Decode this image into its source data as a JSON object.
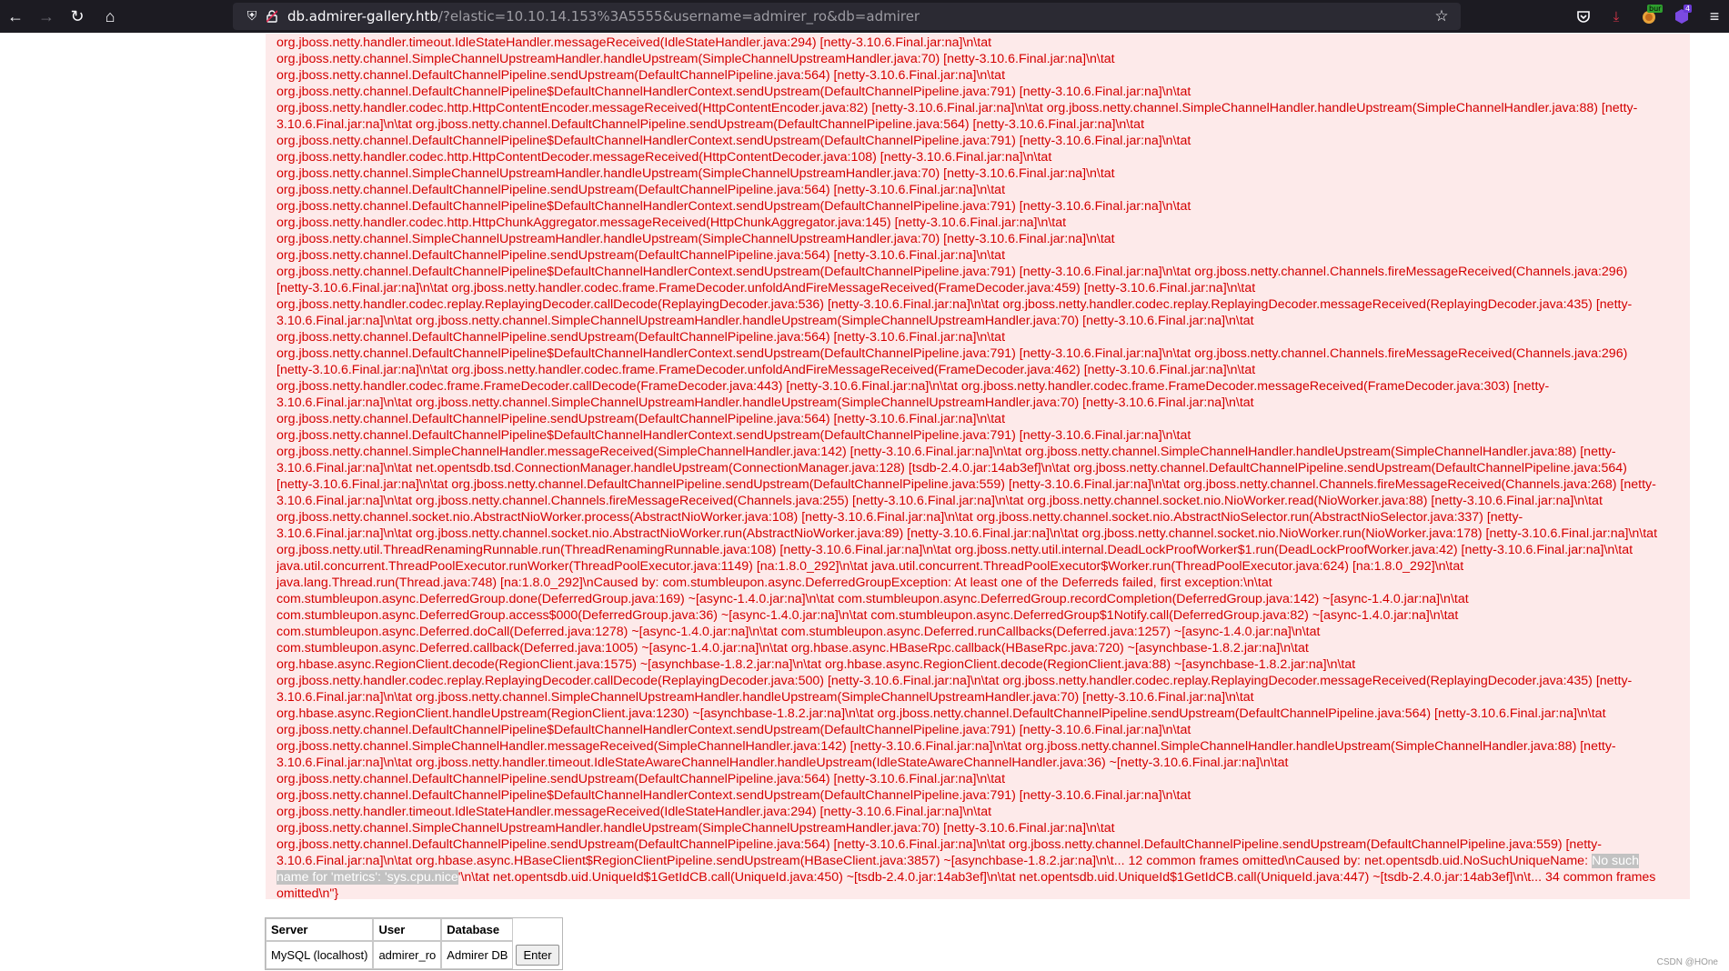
{
  "browser": {
    "url_host": "db.admirer-gallery.htb",
    "url_rest": "/?elastic=10.10.14.153%3A5555&username=admirer_ro&db=admirer",
    "extensions": {
      "burp_badge": "bur",
      "purple_badge": "4"
    }
  },
  "error": {
    "text": "org.jboss.netty.handler.timeout.IdleStateHandler.messageReceived(IdleStateHandler.java:294) [netty-3.10.6.Final.jar:na]\\n\\tat\norg.jboss.netty.channel.SimpleChannelUpstreamHandler.handleUpstream(SimpleChannelUpstreamHandler.java:70) [netty-3.10.6.Final.jar:na]\\n\\tat\norg.jboss.netty.channel.DefaultChannelPipeline.sendUpstream(DefaultChannelPipeline.java:564) [netty-3.10.6.Final.jar:na]\\n\\tat\norg.jboss.netty.channel.DefaultChannelPipeline$DefaultChannelHandlerContext.sendUpstream(DefaultChannelPipeline.java:791) [netty-3.10.6.Final.jar:na]\\n\\tat\norg.jboss.netty.handler.codec.http.HttpContentEncoder.messageReceived(HttpContentEncoder.java:82) [netty-3.10.6.Final.jar:na]\\n\\tat org.jboss.netty.channel.SimpleChannelHandler.handleUpstream(SimpleChannelHandler.java:88) [netty-\n3.10.6.Final.jar:na]\\n\\tat org.jboss.netty.channel.DefaultChannelPipeline.sendUpstream(DefaultChannelPipeline.java:564) [netty-3.10.6.Final.jar:na]\\n\\tat\norg.jboss.netty.channel.DefaultChannelPipeline$DefaultChannelHandlerContext.sendUpstream(DefaultChannelPipeline.java:791) [netty-3.10.6.Final.jar:na]\\n\\tat\norg.jboss.netty.handler.codec.http.HttpContentDecoder.messageReceived(HttpContentDecoder.java:108) [netty-3.10.6.Final.jar:na]\\n\\tat\norg.jboss.netty.channel.SimpleChannelUpstreamHandler.handleUpstream(SimpleChannelUpstreamHandler.java:70) [netty-3.10.6.Final.jar:na]\\n\\tat\norg.jboss.netty.channel.DefaultChannelPipeline.sendUpstream(DefaultChannelPipeline.java:564) [netty-3.10.6.Final.jar:na]\\n\\tat\norg.jboss.netty.channel.DefaultChannelPipeline$DefaultChannelHandlerContext.sendUpstream(DefaultChannelPipeline.java:791) [netty-3.10.6.Final.jar:na]\\n\\tat\norg.jboss.netty.handler.codec.http.HttpChunkAggregator.messageReceived(HttpChunkAggregator.java:145) [netty-3.10.6.Final.jar:na]\\n\\tat\norg.jboss.netty.channel.SimpleChannelUpstreamHandler.handleUpstream(SimpleChannelUpstreamHandler.java:70) [netty-3.10.6.Final.jar:na]\\n\\tat\norg.jboss.netty.channel.DefaultChannelPipeline.sendUpstream(DefaultChannelPipeline.java:564) [netty-3.10.6.Final.jar:na]\\n\\tat\norg.jboss.netty.channel.DefaultChannelPipeline$DefaultChannelHandlerContext.sendUpstream(DefaultChannelPipeline.java:791) [netty-3.10.6.Final.jar:na]\\n\\tat org.jboss.netty.channel.Channels.fireMessageReceived(Channels.java:296)\n[netty-3.10.6.Final.jar:na]\\n\\tat org.jboss.netty.handler.codec.frame.FrameDecoder.unfoldAndFireMessageReceived(FrameDecoder.java:459) [netty-3.10.6.Final.jar:na]\\n\\tat\norg.jboss.netty.handler.codec.replay.ReplayingDecoder.callDecode(ReplayingDecoder.java:536) [netty-3.10.6.Final.jar:na]\\n\\tat org.jboss.netty.handler.codec.replay.ReplayingDecoder.messageReceived(ReplayingDecoder.java:435) [netty-\n3.10.6.Final.jar:na]\\n\\tat org.jboss.netty.channel.SimpleChannelUpstreamHandler.handleUpstream(SimpleChannelUpstreamHandler.java:70) [netty-3.10.6.Final.jar:na]\\n\\tat\norg.jboss.netty.channel.DefaultChannelPipeline.sendUpstream(DefaultChannelPipeline.java:564) [netty-3.10.6.Final.jar:na]\\n\\tat\norg.jboss.netty.channel.DefaultChannelPipeline$DefaultChannelHandlerContext.sendUpstream(DefaultChannelPipeline.java:791) [netty-3.10.6.Final.jar:na]\\n\\tat org.jboss.netty.channel.Channels.fireMessageReceived(Channels.java:296)\n[netty-3.10.6.Final.jar:na]\\n\\tat org.jboss.netty.handler.codec.frame.FrameDecoder.unfoldAndFireMessageReceived(FrameDecoder.java:462) [netty-3.10.6.Final.jar:na]\\n\\tat\norg.jboss.netty.handler.codec.frame.FrameDecoder.callDecode(FrameDecoder.java:443) [netty-3.10.6.Final.jar:na]\\n\\tat org.jboss.netty.handler.codec.frame.FrameDecoder.messageReceived(FrameDecoder.java:303) [netty-\n3.10.6.Final.jar:na]\\n\\tat org.jboss.netty.channel.SimpleChannelUpstreamHandler.handleUpstream(SimpleChannelUpstreamHandler.java:70) [netty-3.10.6.Final.jar:na]\\n\\tat\norg.jboss.netty.channel.DefaultChannelPipeline.sendUpstream(DefaultChannelPipeline.java:564) [netty-3.10.6.Final.jar:na]\\n\\tat\norg.jboss.netty.channel.DefaultChannelPipeline$DefaultChannelHandlerContext.sendUpstream(DefaultChannelPipeline.java:791) [netty-3.10.6.Final.jar:na]\\n\\tat\norg.jboss.netty.channel.SimpleChannelHandler.messageReceived(SimpleChannelHandler.java:142) [netty-3.10.6.Final.jar:na]\\n\\tat org.jboss.netty.channel.SimpleChannelHandler.handleUpstream(SimpleChannelHandler.java:88) [netty-\n3.10.6.Final.jar:na]\\n\\tat net.opentsdb.tsd.ConnectionManager.handleUpstream(ConnectionManager.java:128) [tsdb-2.4.0.jar:14ab3ef]\\n\\tat org.jboss.netty.channel.DefaultChannelPipeline.sendUpstream(DefaultChannelPipeline.java:564)\n[netty-3.10.6.Final.jar:na]\\n\\tat org.jboss.netty.channel.DefaultChannelPipeline.sendUpstream(DefaultChannelPipeline.java:559) [netty-3.10.6.Final.jar:na]\\n\\tat org.jboss.netty.channel.Channels.fireMessageReceived(Channels.java:268) [netty-\n3.10.6.Final.jar:na]\\n\\tat org.jboss.netty.channel.Channels.fireMessageReceived(Channels.java:255) [netty-3.10.6.Final.jar:na]\\n\\tat org.jboss.netty.channel.socket.nio.NioWorker.read(NioWorker.java:88) [netty-3.10.6.Final.jar:na]\\n\\tat\norg.jboss.netty.channel.socket.nio.AbstractNioWorker.process(AbstractNioWorker.java:108) [netty-3.10.6.Final.jar:na]\\n\\tat org.jboss.netty.channel.socket.nio.AbstractNioSelector.run(AbstractNioSelector.java:337) [netty-\n3.10.6.Final.jar:na]\\n\\tat org.jboss.netty.channel.socket.nio.AbstractNioWorker.run(AbstractNioWorker.java:89) [netty-3.10.6.Final.jar:na]\\n\\tat org.jboss.netty.channel.socket.nio.NioWorker.run(NioWorker.java:178) [netty-3.10.6.Final.jar:na]\\n\\tat\norg.jboss.netty.util.ThreadRenamingRunnable.run(ThreadRenamingRunnable.java:108) [netty-3.10.6.Final.jar:na]\\n\\tat org.jboss.netty.util.internal.DeadLockProofWorker$1.run(DeadLockProofWorker.java:42) [netty-3.10.6.Final.jar:na]\\n\\tat\njava.util.concurrent.ThreadPoolExecutor.runWorker(ThreadPoolExecutor.java:1149) [na:1.8.0_292]\\n\\tat java.util.concurrent.ThreadPoolExecutor$Worker.run(ThreadPoolExecutor.java:624) [na:1.8.0_292]\\n\\tat\njava.lang.Thread.run(Thread.java:748) [na:1.8.0_292]\\nCaused by: com.stumbleupon.async.DeferredGroupException: At least one of the Deferreds failed, first exception:\\n\\tat\ncom.stumbleupon.async.DeferredGroup.done(DeferredGroup.java:169) ~[async-1.4.0.jar:na]\\n\\tat com.stumbleupon.async.DeferredGroup.recordCompletion(DeferredGroup.java:142) ~[async-1.4.0.jar:na]\\n\\tat\ncom.stumbleupon.async.DeferredGroup.access$000(DeferredGroup.java:36) ~[async-1.4.0.jar:na]\\n\\tat com.stumbleupon.async.DeferredGroup$1Notify.call(DeferredGroup.java:82) ~[async-1.4.0.jar:na]\\n\\tat\ncom.stumbleupon.async.Deferred.doCall(Deferred.java:1278) ~[async-1.4.0.jar:na]\\n\\tat com.stumbleupon.async.Deferred.runCallbacks(Deferred.java:1257) ~[async-1.4.0.jar:na]\\n\\tat\ncom.stumbleupon.async.Deferred.callback(Deferred.java:1005) ~[async-1.4.0.jar:na]\\n\\tat org.hbase.async.HBaseRpc.callback(HBaseRpc.java:720) ~[asynchbase-1.8.2.jar:na]\\n\\tat\norg.hbase.async.RegionClient.decode(RegionClient.java:1575) ~[asynchbase-1.8.2.jar:na]\\n\\tat org.hbase.async.RegionClient.decode(RegionClient.java:88) ~[asynchbase-1.8.2.jar:na]\\n\\tat\norg.jboss.netty.handler.codec.replay.ReplayingDecoder.callDecode(ReplayingDecoder.java:500) [netty-3.10.6.Final.jar:na]\\n\\tat org.jboss.netty.handler.codec.replay.ReplayingDecoder.messageReceived(ReplayingDecoder.java:435) [netty-\n3.10.6.Final.jar:na]\\n\\tat org.jboss.netty.channel.SimpleChannelUpstreamHandler.handleUpstream(SimpleChannelUpstreamHandler.java:70) [netty-3.10.6.Final.jar:na]\\n\\tat\norg.hbase.async.RegionClient.handleUpstream(RegionClient.java:1230) ~[asynchbase-1.8.2.jar:na]\\n\\tat org.jboss.netty.channel.DefaultChannelPipeline.sendUpstream(DefaultChannelPipeline.java:564) [netty-3.10.6.Final.jar:na]\\n\\tat\norg.jboss.netty.channel.DefaultChannelPipeline$DefaultChannelHandlerContext.sendUpstream(DefaultChannelPipeline.java:791) [netty-3.10.6.Final.jar:na]\\n\\tat\norg.jboss.netty.channel.SimpleChannelHandler.messageReceived(SimpleChannelHandler.java:142) [netty-3.10.6.Final.jar:na]\\n\\tat org.jboss.netty.channel.SimpleChannelHandler.handleUpstream(SimpleChannelHandler.java:88) [netty-\n3.10.6.Final.jar:na]\\n\\tat org.jboss.netty.handler.timeout.IdleStateAwareChannelHandler.handleUpstream(IdleStateAwareChannelHandler.java:36) ~[netty-3.10.6.Final.jar:na]\\n\\tat\norg.jboss.netty.channel.DefaultChannelPipeline.sendUpstream(DefaultChannelPipeline.java:564) [netty-3.10.6.Final.jar:na]\\n\\tat\norg.jboss.netty.channel.DefaultChannelPipeline$DefaultChannelHandlerContext.sendUpstream(DefaultChannelPipeline.java:791) [netty-3.10.6.Final.jar:na]\\n\\tat\norg.jboss.netty.handler.timeout.IdleStateHandler.messageReceived(IdleStateHandler.java:294) [netty-3.10.6.Final.jar:na]\\n\\tat\norg.jboss.netty.channel.SimpleChannelUpstreamHandler.handleUpstream(SimpleChannelUpstreamHandler.java:70) [netty-3.10.6.Final.jar:na]\\n\\tat\norg.jboss.netty.channel.DefaultChannelPipeline.sendUpstream(DefaultChannelPipeline.java:564) [netty-3.10.6.Final.jar:na]\\n\\tat org.jboss.netty.channel.DefaultChannelPipeline.sendUpstream(DefaultChannelPipeline.java:559) [netty-\n3.10.6.Final.jar:na]\\n\\tat org.hbase.async.HBaseClient$RegionClientPipeline.sendUpstream(HBaseClient.java:3857) ~[asynchbase-1.8.2.jar:na]\\n\\t... 12 common frames omitted\\nCaused by: net.opentsdb.uid.NoSuchUniqueName: ",
    "highlight": "No such\nname for 'metrics': 'sys.cpu.nice",
    "tail": "'\\n\\tat net.opentsdb.uid.UniqueId$1GetIdCB.call(UniqueId.java:450) ~[tsdb-2.4.0.jar:14ab3ef]\\n\\tat net.opentsdb.uid.UniqueId$1GetIdCB.call(UniqueId.java:447) ~[tsdb-2.4.0.jar:14ab3ef]\\n\\t... 34 common frames\nomitted\\n\"}"
  },
  "login": {
    "headers": {
      "server": "Server",
      "user": "User",
      "database": "Database"
    },
    "row": {
      "server": "MySQL (localhost)",
      "user": "admirer_ro",
      "database": "Admirer DB"
    },
    "enter_label": "Enter"
  },
  "watermark": "CSDN @HOne"
}
